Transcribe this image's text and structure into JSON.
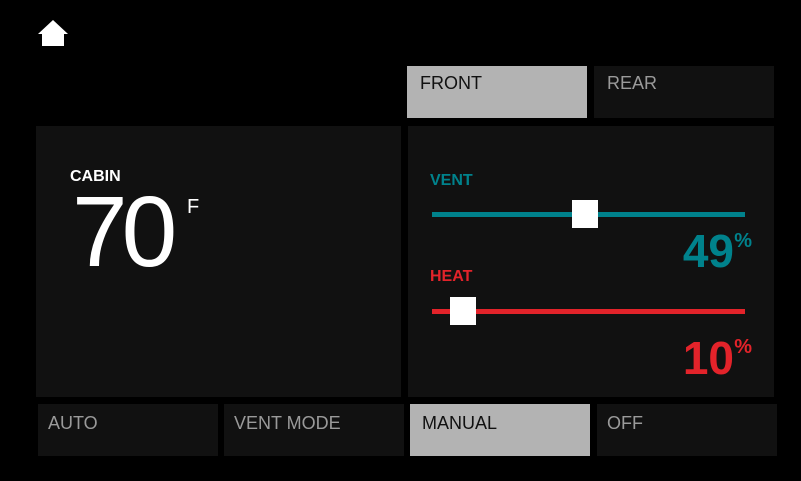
{
  "colors": {
    "vent": "#00828c",
    "heat": "#e3232a",
    "active_bg": "#b3b3b3",
    "panel_bg": "#111111"
  },
  "home": {
    "icon": "home-icon"
  },
  "zones": [
    {
      "label": "FRONT",
      "active": true
    },
    {
      "label": "REAR",
      "active": false
    }
  ],
  "cabin": {
    "label": "CABIN",
    "temperature": "70",
    "unit": "F"
  },
  "vent": {
    "label": "VENT",
    "value": "49",
    "unit": "%",
    "level": 0.49
  },
  "heat": {
    "label": "HEAT",
    "value": "10",
    "unit": "%",
    "level": 0.1
  },
  "modes": [
    {
      "label": "AUTO",
      "active": false
    },
    {
      "label": "VENT MODE",
      "active": false
    },
    {
      "label": "MANUAL",
      "active": true
    },
    {
      "label": "OFF",
      "active": false
    }
  ]
}
